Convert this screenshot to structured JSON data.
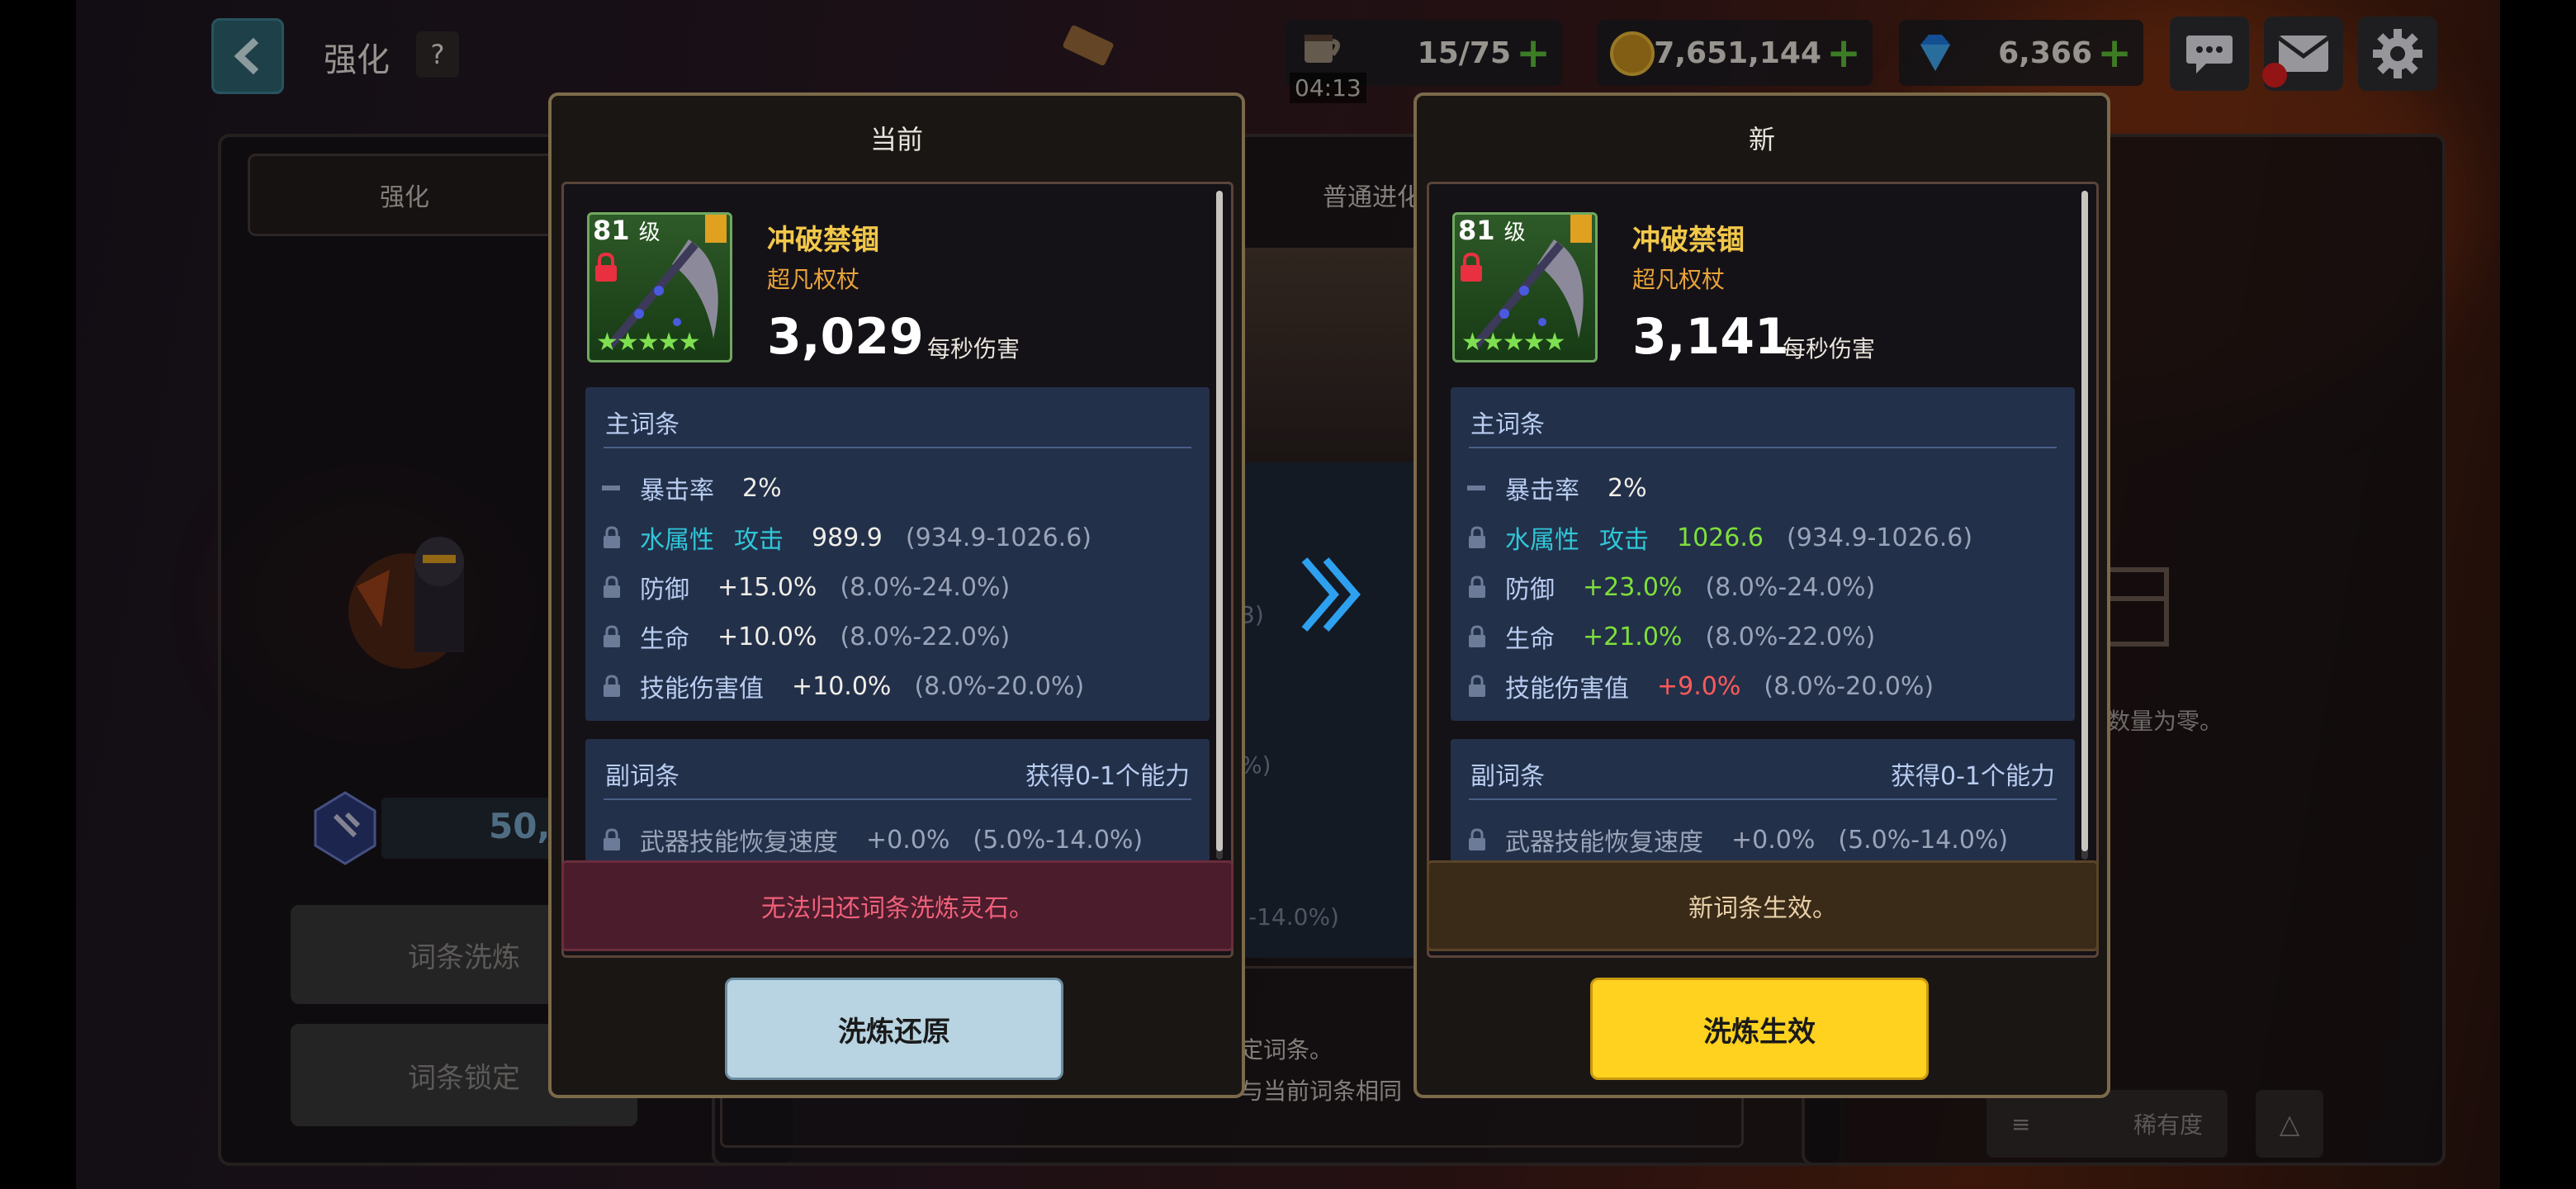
{
  "header": {
    "title": "强化",
    "help_label": "?"
  },
  "resources": {
    "stamina": {
      "value": "15/75",
      "timer": "04:13"
    },
    "gold": {
      "value": "7,651,144"
    },
    "gems": {
      "value": "6,366"
    }
  },
  "background": {
    "tab_enhance": "强化",
    "tab_evolve": "普通进化",
    "counter": "50,",
    "btn_reroll": "词条洗炼",
    "btn_lock": "词条锁定",
    "empty_text": "数量为零。",
    "partial_1": "3)",
    "partial_2": "%)",
    "partial_3": "-14.0%)",
    "bottom_text_1": "定词条。",
    "bottom_text_2": "与当前词条相同",
    "sort_label": "稀有度"
  },
  "current": {
    "header": "当前",
    "level": "81",
    "level_unit": "级",
    "item_name": "冲破禁锢",
    "item_type": "超凡权杖",
    "dps": "3,029",
    "dps_label": "每秒伤害",
    "main_title": "主词条",
    "main_rows": [
      {
        "name": "暴击率",
        "name2": "",
        "value": "2%",
        "range": ""
      },
      {
        "name": "水属性",
        "name2": "攻击",
        "value": "989.9",
        "range": "(934.9-1026.6)"
      },
      {
        "name": "防御",
        "name2": "",
        "value": "+15.0%",
        "range": "(8.0%-24.0%)"
      },
      {
        "name": "生命",
        "name2": "",
        "value": "+10.0%",
        "range": "(8.0%-22.0%)"
      },
      {
        "name": "技能伤害值",
        "name2": "",
        "value": "+10.0%",
        "range": "(8.0%-20.0%)"
      }
    ],
    "sub_title": "副词条",
    "sub_right": "获得0-1个能力",
    "sub_rows": [
      {
        "name": "武器技能恢复速度",
        "value": "+0.0%",
        "range": "(5.0%-14.0%)"
      }
    ],
    "notice": "无法归还词条洗炼灵石。",
    "button": "洗炼还原"
  },
  "new": {
    "header": "新",
    "level": "81",
    "level_unit": "级",
    "item_name": "冲破禁锢",
    "item_type": "超凡权杖",
    "dps": "3,141",
    "dps_label": "每秒伤害",
    "main_title": "主词条",
    "main_rows": [
      {
        "name": "暴击率",
        "name2": "",
        "value": "2%",
        "range": ""
      },
      {
        "name": "水属性",
        "name2": "攻击",
        "value": "1026.6",
        "range": "(934.9-1026.6)"
      },
      {
        "name": "防御",
        "name2": "",
        "value": "+23.0%",
        "range": "(8.0%-24.0%)"
      },
      {
        "name": "生命",
        "name2": "",
        "value": "+21.0%",
        "range": "(8.0%-22.0%)"
      },
      {
        "name": "技能伤害值",
        "name2": "",
        "value": "+9.0%",
        "range": "(8.0%-20.0%)"
      }
    ],
    "sub_title": "副词条",
    "sub_right": "获得0-1个能力",
    "sub_rows": [
      {
        "name": "武器技能恢复速度",
        "value": "+0.0%",
        "range": "(5.0%-14.0%)"
      }
    ],
    "notice": "新词条生效。",
    "button": "洗炼生效"
  },
  "colors": {
    "accent_yellow": "#ffd21f",
    "restore_button": "#b8d4e2",
    "increase_green": "#7ee03a",
    "decrease_red": "#ff5a5a",
    "notice_red_bg": "#4a1c2c",
    "notice_brown_bg": "#3a2a18"
  }
}
